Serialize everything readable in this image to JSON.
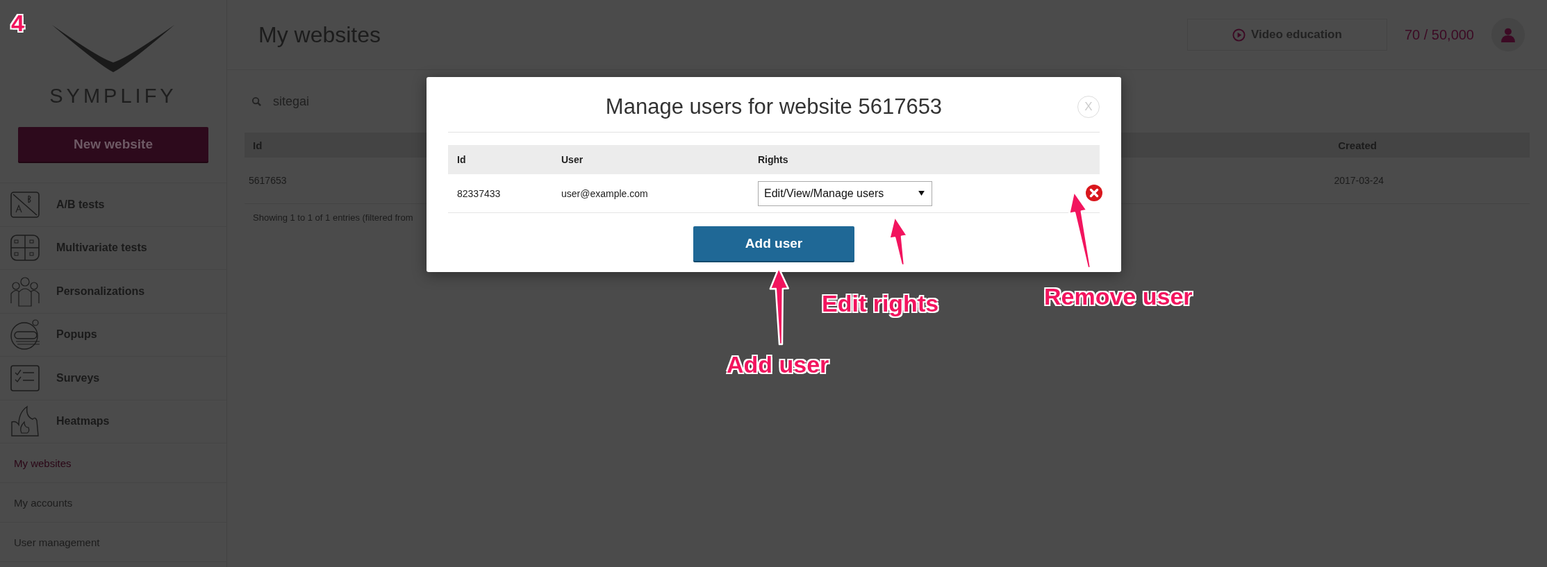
{
  "step_badge": "4",
  "sidebar": {
    "logo": "SYMPLIFY",
    "new_button": "New website",
    "nav_items": [
      {
        "label": "A/B tests",
        "kind": "ab"
      },
      {
        "label": "Multivariate tests",
        "kind": "grid"
      },
      {
        "label": "Personalizations",
        "kind": "people"
      },
      {
        "label": "Popups",
        "kind": "popup"
      },
      {
        "label": "Surveys",
        "kind": "survey"
      },
      {
        "label": "Heatmaps",
        "kind": "flame"
      }
    ],
    "links": [
      {
        "label": "My websites",
        "selected": true
      },
      {
        "label": "My accounts",
        "selected": false
      },
      {
        "label": "User management",
        "selected": false
      }
    ]
  },
  "header": {
    "title": "My websites",
    "video_button": "Video education",
    "counter": "70 / 50,000"
  },
  "search": {
    "value": "sitegai"
  },
  "table": {
    "columns": [
      "Id",
      "Created"
    ],
    "rows": [
      {
        "cells": [
          "5617653",
          "2017-03-24"
        ]
      }
    ],
    "footer": "Showing 1 to 1 of 1 entries (filtered from"
  },
  "modal": {
    "title": "Manage users for website 5617653",
    "close": "X",
    "columns": [
      "Id",
      "User",
      "Rights"
    ],
    "rows": [
      {
        "id": "82337433",
        "user": "user@example.com",
        "rights": "Edit/View/Manage users"
      }
    ],
    "add_button": "Add user"
  },
  "annotations": [
    {
      "label": "Edit rights"
    },
    {
      "label": "Remove user"
    },
    {
      "label": "Add user"
    }
  ]
}
